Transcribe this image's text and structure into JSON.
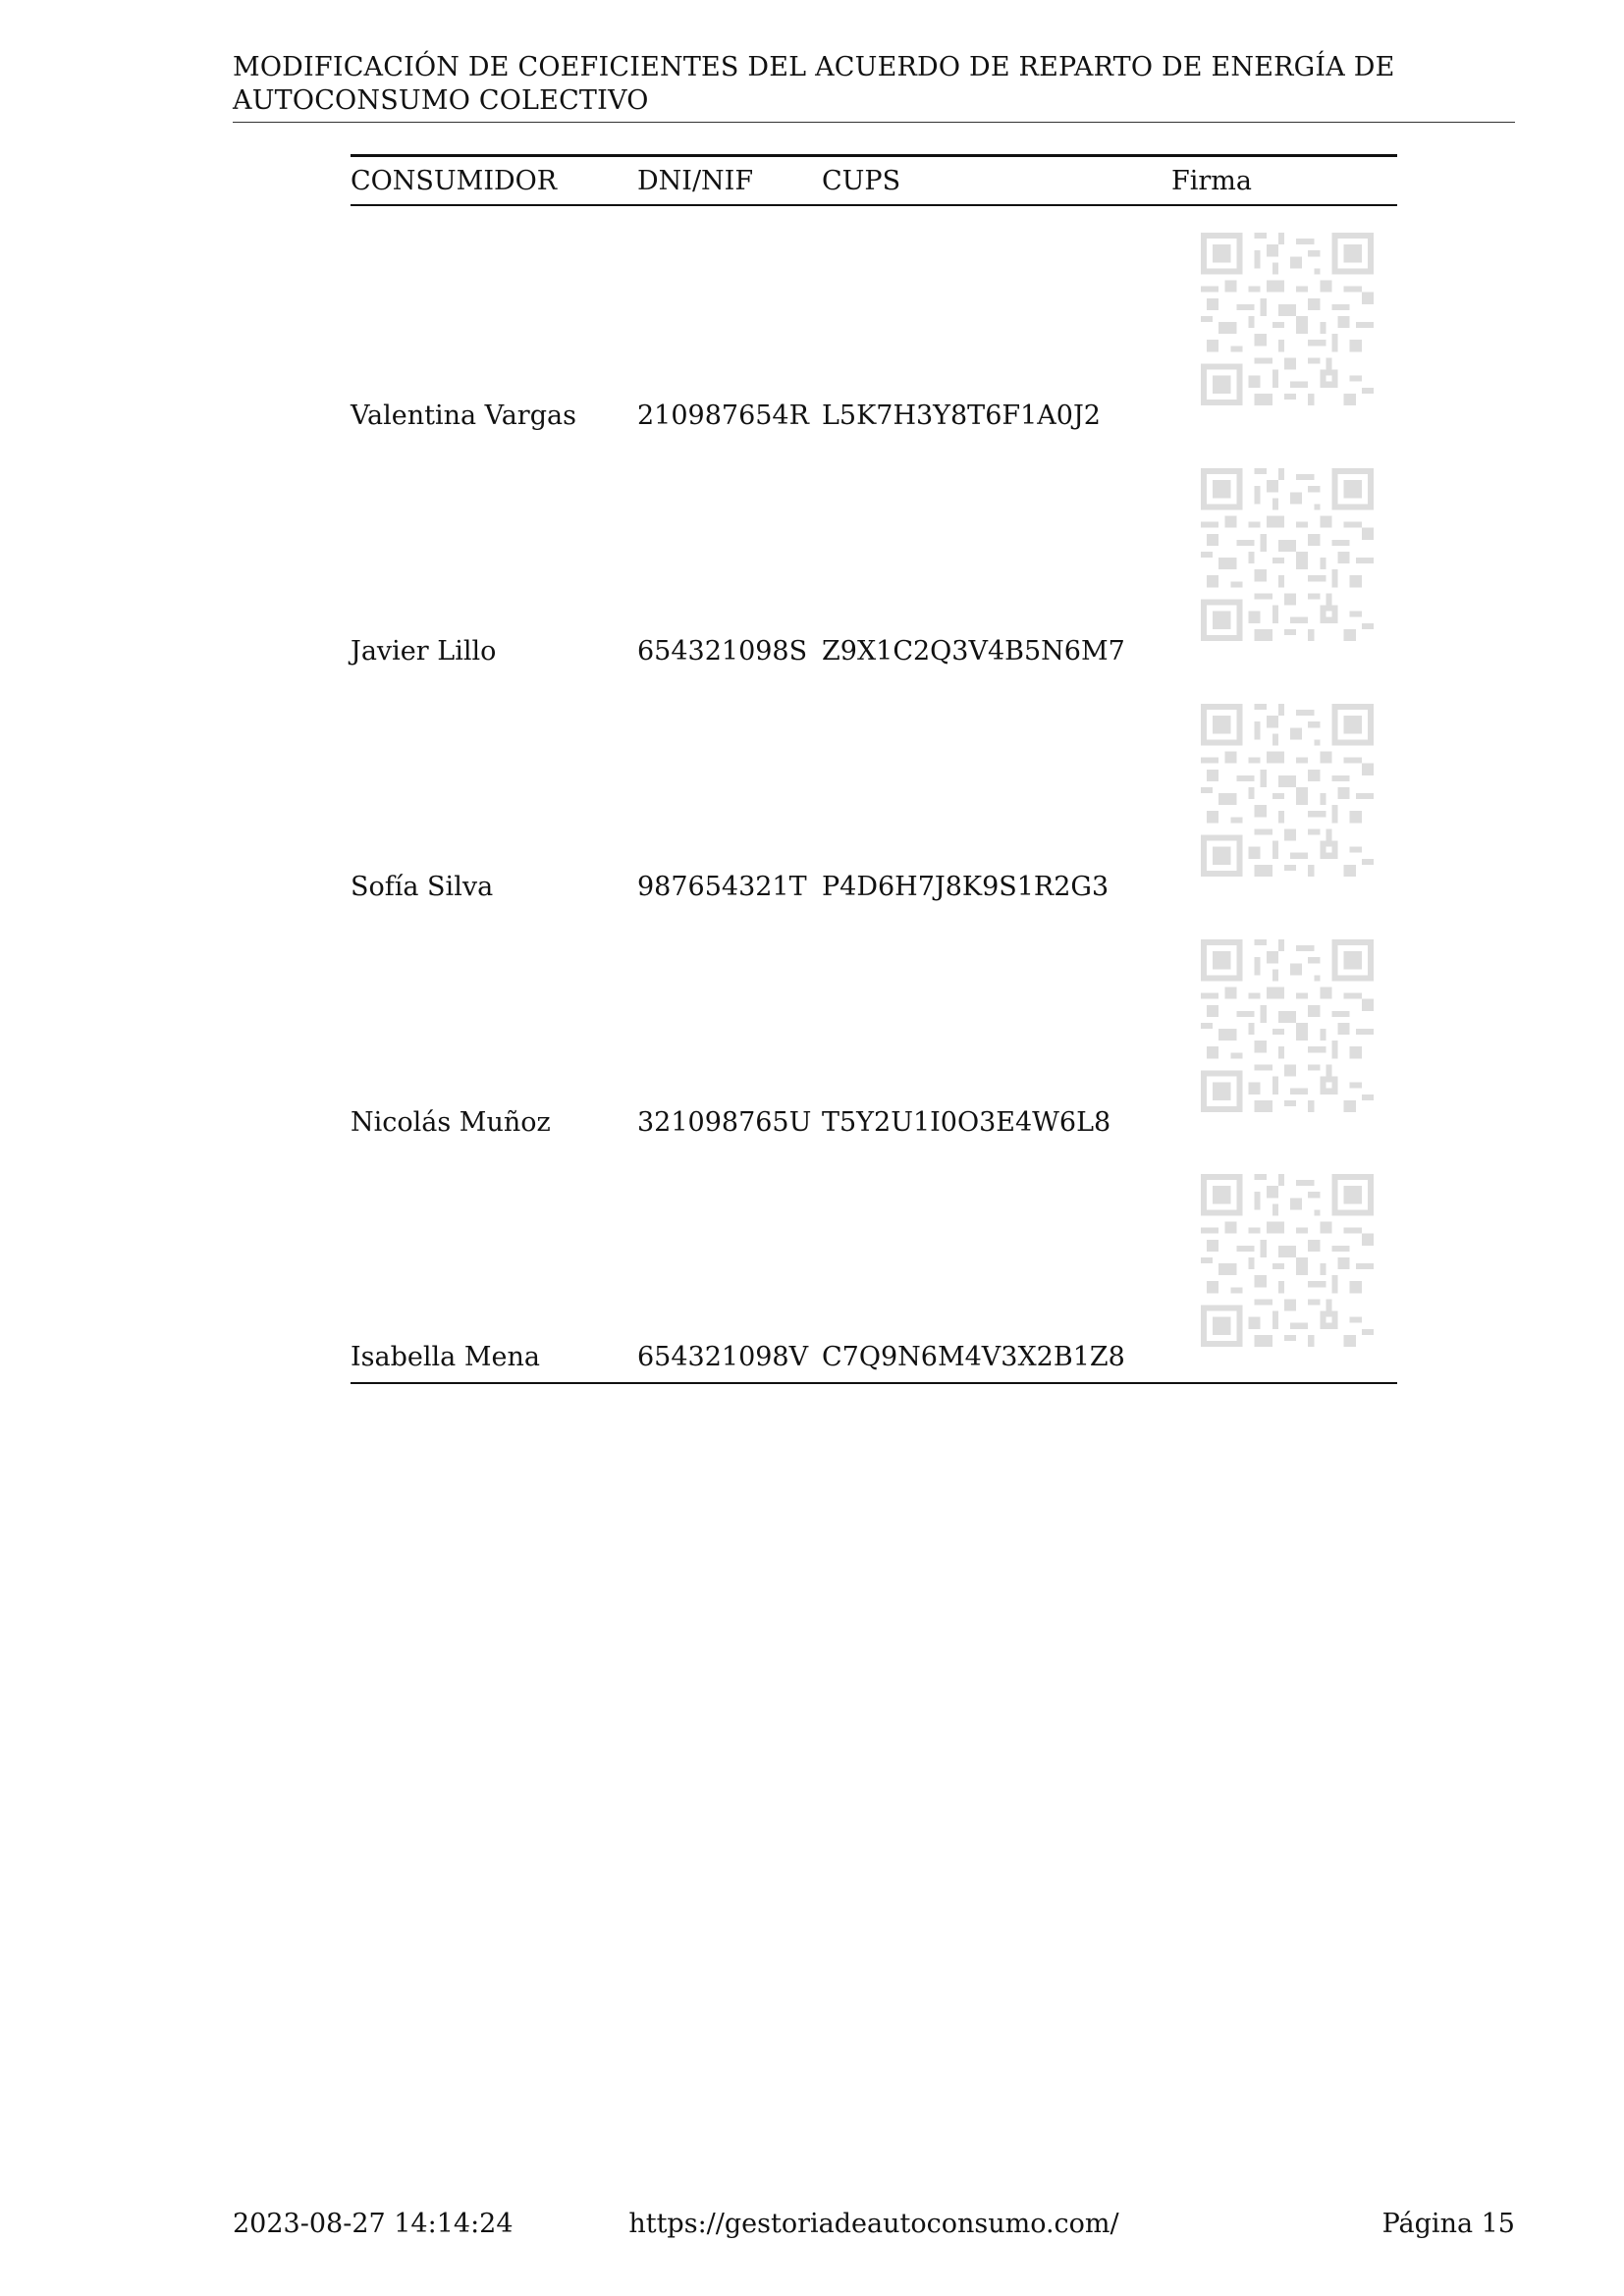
{
  "document": {
    "title": "MODIFICACIÓN DE COEFICIENTES DEL ACUERDO DE REPARTO DE ENERGÍA DE AUTOCONSUMO COLECTIVO"
  },
  "table": {
    "headers": {
      "consumer": "CONSUMIDOR",
      "dni": "DNI/NIF",
      "cups": "CUPS",
      "signature": "Firma"
    },
    "rows": [
      {
        "name": "Valentina Vargas",
        "dni": "210987654R",
        "cups": "L5K7H3Y8T6F1A0J2",
        "signature_icon": "qr-code-icon"
      },
      {
        "name": "Javier Lillo",
        "dni": "654321098S",
        "cups": "Z9X1C2Q3V4B5N6M7",
        "signature_icon": "qr-code-icon"
      },
      {
        "name": "Sofía Silva",
        "dni": "987654321T",
        "cups": "P4D6H7J8K9S1R2G3",
        "signature_icon": "qr-code-icon"
      },
      {
        "name": "Nicolás Muñoz",
        "dni": "321098765U",
        "cups": "T5Y2U1I0O3E4W6L8",
        "signature_icon": "qr-code-icon"
      },
      {
        "name": "Isabella Mena",
        "dni": "654321098V",
        "cups": "C7Q9N6M4V3X2B1Z8",
        "signature_icon": "qr-code-icon"
      }
    ]
  },
  "footer": {
    "timestamp": "2023-08-27 14:14:24",
    "url": "https://gestoriadeautoconsumo.com/",
    "page": "Página 15"
  }
}
